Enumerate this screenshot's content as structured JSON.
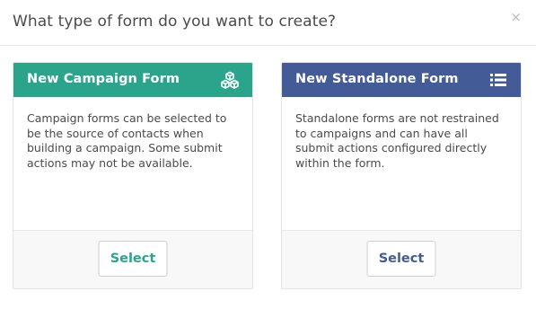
{
  "dialog": {
    "title": "What type of form do you want to create?",
    "close_glyph": "×"
  },
  "cards": [
    {
      "title": "New Campaign Form",
      "icon": "cubes-icon",
      "color": "#2aa58b",
      "description": "Campaign forms can be selected to be the source of contacts when building a campaign. Some submit actions may not be available.",
      "button_label": "Select"
    },
    {
      "title": "New Standalone Form",
      "icon": "list-icon",
      "color": "#435b96",
      "description": "Standalone forms are not restrained to campaigns and can have all submit actions configured directly within the form.",
      "button_label": "Select"
    }
  ]
}
